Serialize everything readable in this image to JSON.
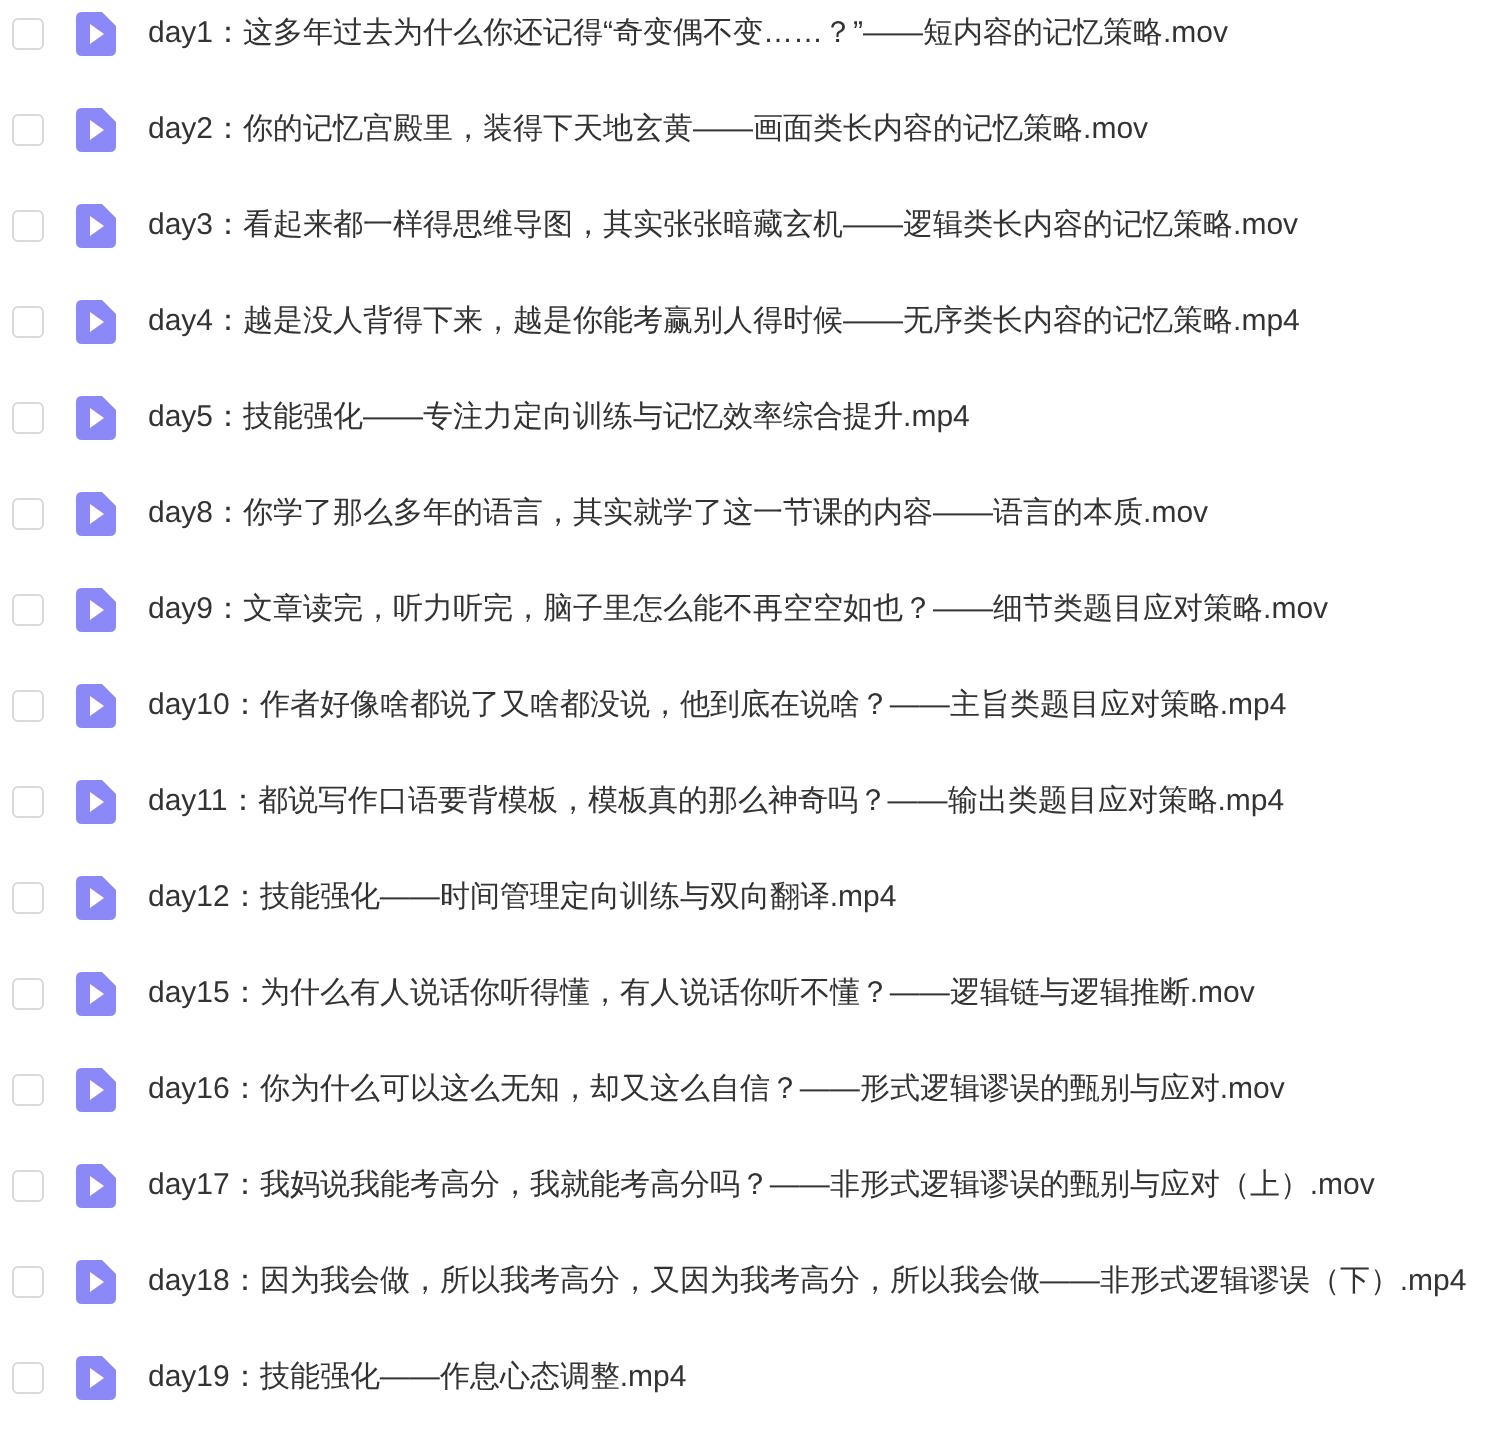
{
  "files": [
    {
      "name": "day1：这多年过去为什么你还记得“奇变偶不变……？”——短内容的记忆策略.mov",
      "checked": false
    },
    {
      "name": "day2：你的记忆宫殿里，装得下天地玄黄——画面类长内容的记忆策略.mov",
      "checked": false
    },
    {
      "name": "day3：看起来都一样得思维导图，其实张张暗藏玄机——逻辑类长内容的记忆策略.mov",
      "checked": false
    },
    {
      "name": "day4：越是没人背得下来，越是你能考赢别人得时候——无序类长内容的记忆策略.mp4",
      "checked": false
    },
    {
      "name": "day5：技能强化——专注力定向训练与记忆效率综合提升.mp4",
      "checked": false
    },
    {
      "name": "day8：你学了那么多年的语言，其实就学了这一节课的内容——语言的本质.mov",
      "checked": false
    },
    {
      "name": "day9：文章读完，听力听完，脑子里怎么能不再空空如也？——细节类题目应对策略.mov",
      "checked": false
    },
    {
      "name": "day10：作者好像啥都说了又啥都没说，他到底在说啥？——主旨类题目应对策略.mp4",
      "checked": false
    },
    {
      "name": "day11：都说写作口语要背模板，模板真的那么神奇吗？——输出类题目应对策略.mp4",
      "checked": false
    },
    {
      "name": "day12：技能强化——时间管理定向训练与双向翻译.mp4",
      "checked": false
    },
    {
      "name": "day15：为什么有人说话你听得懂，有人说话你听不懂？——逻辑链与逻辑推断.mov",
      "checked": false
    },
    {
      "name": "day16：你为什么可以这么无知，却又这么自信？——形式逻辑谬误的甄别与应对.mov",
      "checked": false
    },
    {
      "name": "day17：我妈说我能考高分，我就能考高分吗？——非形式逻辑谬误的甄别与应对（上）.mov",
      "checked": false
    },
    {
      "name": "day18：因为我会做，所以我考高分，又因为我考高分，所以我会做——非形式逻辑谬误（下）.mp4",
      "checked": false
    },
    {
      "name": "day19：技能强化——作息心态调整.mp4",
      "checked": false
    }
  ]
}
